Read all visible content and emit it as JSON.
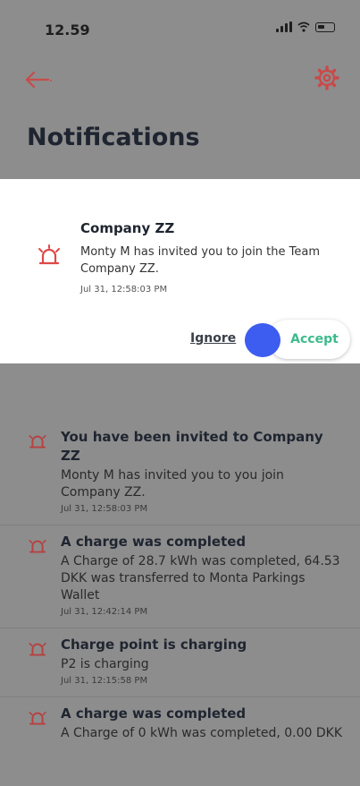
{
  "status_bar": {
    "time": "12.59"
  },
  "header": {
    "title": "Notifications"
  },
  "invite": {
    "title": "Company ZZ",
    "body": "Monty M has invited you to join the Team Company ZZ.",
    "time": "Jul 31, 12:58:03 PM",
    "ignore_label": "Ignore",
    "accept_label": "Accept"
  },
  "notifications": [
    {
      "title": "You have been invited to Company ZZ",
      "body": "Monty M has invited you to you join Company ZZ.",
      "time": "Jul 31, 12:58:03 PM"
    },
    {
      "title": "A charge was completed",
      "body": "A Charge of 28.7 kWh was completed, 64.53 DKK was transferred to Monta Parkings Wallet",
      "time": "Jul 31, 12:42:14 PM"
    },
    {
      "title": "Charge point is charging",
      "body": "P2 is charging",
      "time": "Jul 31, 12:15:58 PM"
    },
    {
      "title": "A charge was completed",
      "body": "A Charge of 0 kWh was completed, 0.00 DKK",
      "time": ""
    }
  ],
  "colors": {
    "accent": "#e04848",
    "accept": "#3dbb8c",
    "overlay": "#8d8d8d"
  },
  "icons": {
    "back": "arrow-left-icon",
    "settings": "gear-icon",
    "notification": "alarm-bell-icon"
  }
}
